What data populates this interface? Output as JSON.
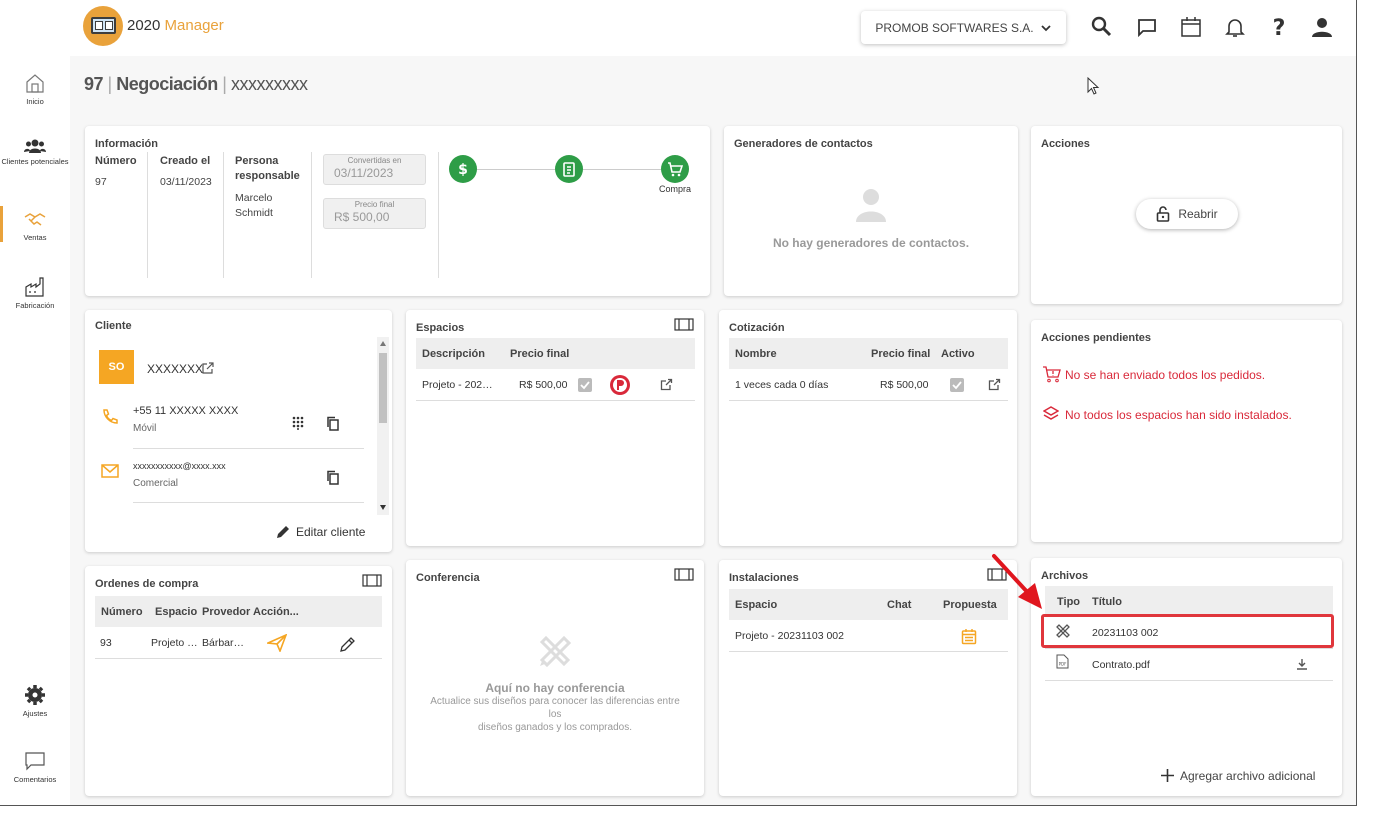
{
  "app": {
    "logo_prefix": "2020",
    "logo_suffix": " Manager"
  },
  "header": {
    "company": "PROMOB SOFTWARES S.A."
  },
  "sidebar": {
    "items": [
      {
        "label": "Inicio",
        "icon": "home-icon"
      },
      {
        "label": "Clientes potenciales",
        "icon": "users-icon"
      },
      {
        "label": "Ventas",
        "icon": "handshake-icon"
      },
      {
        "label": "Fabricación",
        "icon": "factory-icon"
      },
      {
        "label": "Ajustes",
        "icon": "gear-icon"
      },
      {
        "label": "Comentarios",
        "icon": "comment-icon"
      }
    ]
  },
  "page": {
    "number": "97",
    "type": "Negociación",
    "name": "xxxxxxxxx"
  },
  "info": {
    "title": "Información",
    "numero_label": "Número",
    "numero": "97",
    "creado_label": "Creado el",
    "creado": "03/11/2023",
    "persona_label_1": "Persona",
    "persona_label_2": "responsable",
    "persona_1": "Marcelo",
    "persona_2": "Schmidt",
    "convertidas_label": "Convertidas en",
    "convertidas": "03/11/2023",
    "precio_label": "Precio final",
    "precio": "R$ 500,00",
    "step_label": "Compra"
  },
  "generadores": {
    "title": "Generadores de contactos",
    "empty": "No hay generadores de contactos."
  },
  "acciones": {
    "title": "Acciones",
    "reabrir": "Reabrir"
  },
  "cliente": {
    "title": "Cliente",
    "initials": "SO",
    "name": "XXXXXXX",
    "phone": "+55 11 XXXXX XXXX",
    "phone_type": "Móvil",
    "email": "xxxxxxxxxxx@xxxx.xxx",
    "email_type": "Comercial",
    "edit": "Editar cliente"
  },
  "espacios": {
    "title": "Espacios",
    "headers": [
      "Descripción",
      "Precio final"
    ],
    "rows": [
      {
        "descripcion": "Projeto - 202…",
        "precio": "R$ 500,00"
      }
    ]
  },
  "cotizacion": {
    "title": "Cotización",
    "headers": [
      "Nombre",
      "Precio final",
      "Activo"
    ],
    "rows": [
      {
        "nombre": "1 veces cada 0 días",
        "precio": "R$ 500,00"
      }
    ]
  },
  "pendientes": {
    "title": "Acciones pendientes",
    "items": [
      "No se han enviado todos los pedidos.",
      "No todos los espacios han sido instalados."
    ],
    "color": "#d9293a"
  },
  "ordenes": {
    "title": "Ordenes de compra",
    "headers": [
      "Número",
      "Espacio",
      "Provedor",
      "Acción..."
    ],
    "rows": [
      {
        "numero": "93",
        "espacio": "Projeto …",
        "proveedor": "Bárbar…"
      }
    ]
  },
  "conferencia": {
    "title": "Conferencia",
    "empty_title": "Aquí no hay conferencia",
    "empty_line1": "Actualice sus diseños para conocer las diferencias entre",
    "empty_line2": "los",
    "empty_line3": "diseños ganados y los comprados."
  },
  "instalaciones": {
    "title": "Instalaciones",
    "headers": [
      "Espacio",
      "Chat",
      "Propuesta"
    ],
    "rows": [
      {
        "espacio": "Projeto - 20231103 002"
      }
    ]
  },
  "archivos": {
    "title": "Archivos",
    "headers": [
      "Tipo",
      "Título"
    ],
    "rows": [
      {
        "titulo": "20231103 002",
        "icon": "design-icon"
      },
      {
        "titulo": "Contrato.pdf",
        "icon": "pdf-icon"
      }
    ],
    "add": "Agregar archivo adicional"
  },
  "colors": {
    "accent": "#e9a23b",
    "green": "#2e9d47",
    "alert": "#d9293a"
  }
}
